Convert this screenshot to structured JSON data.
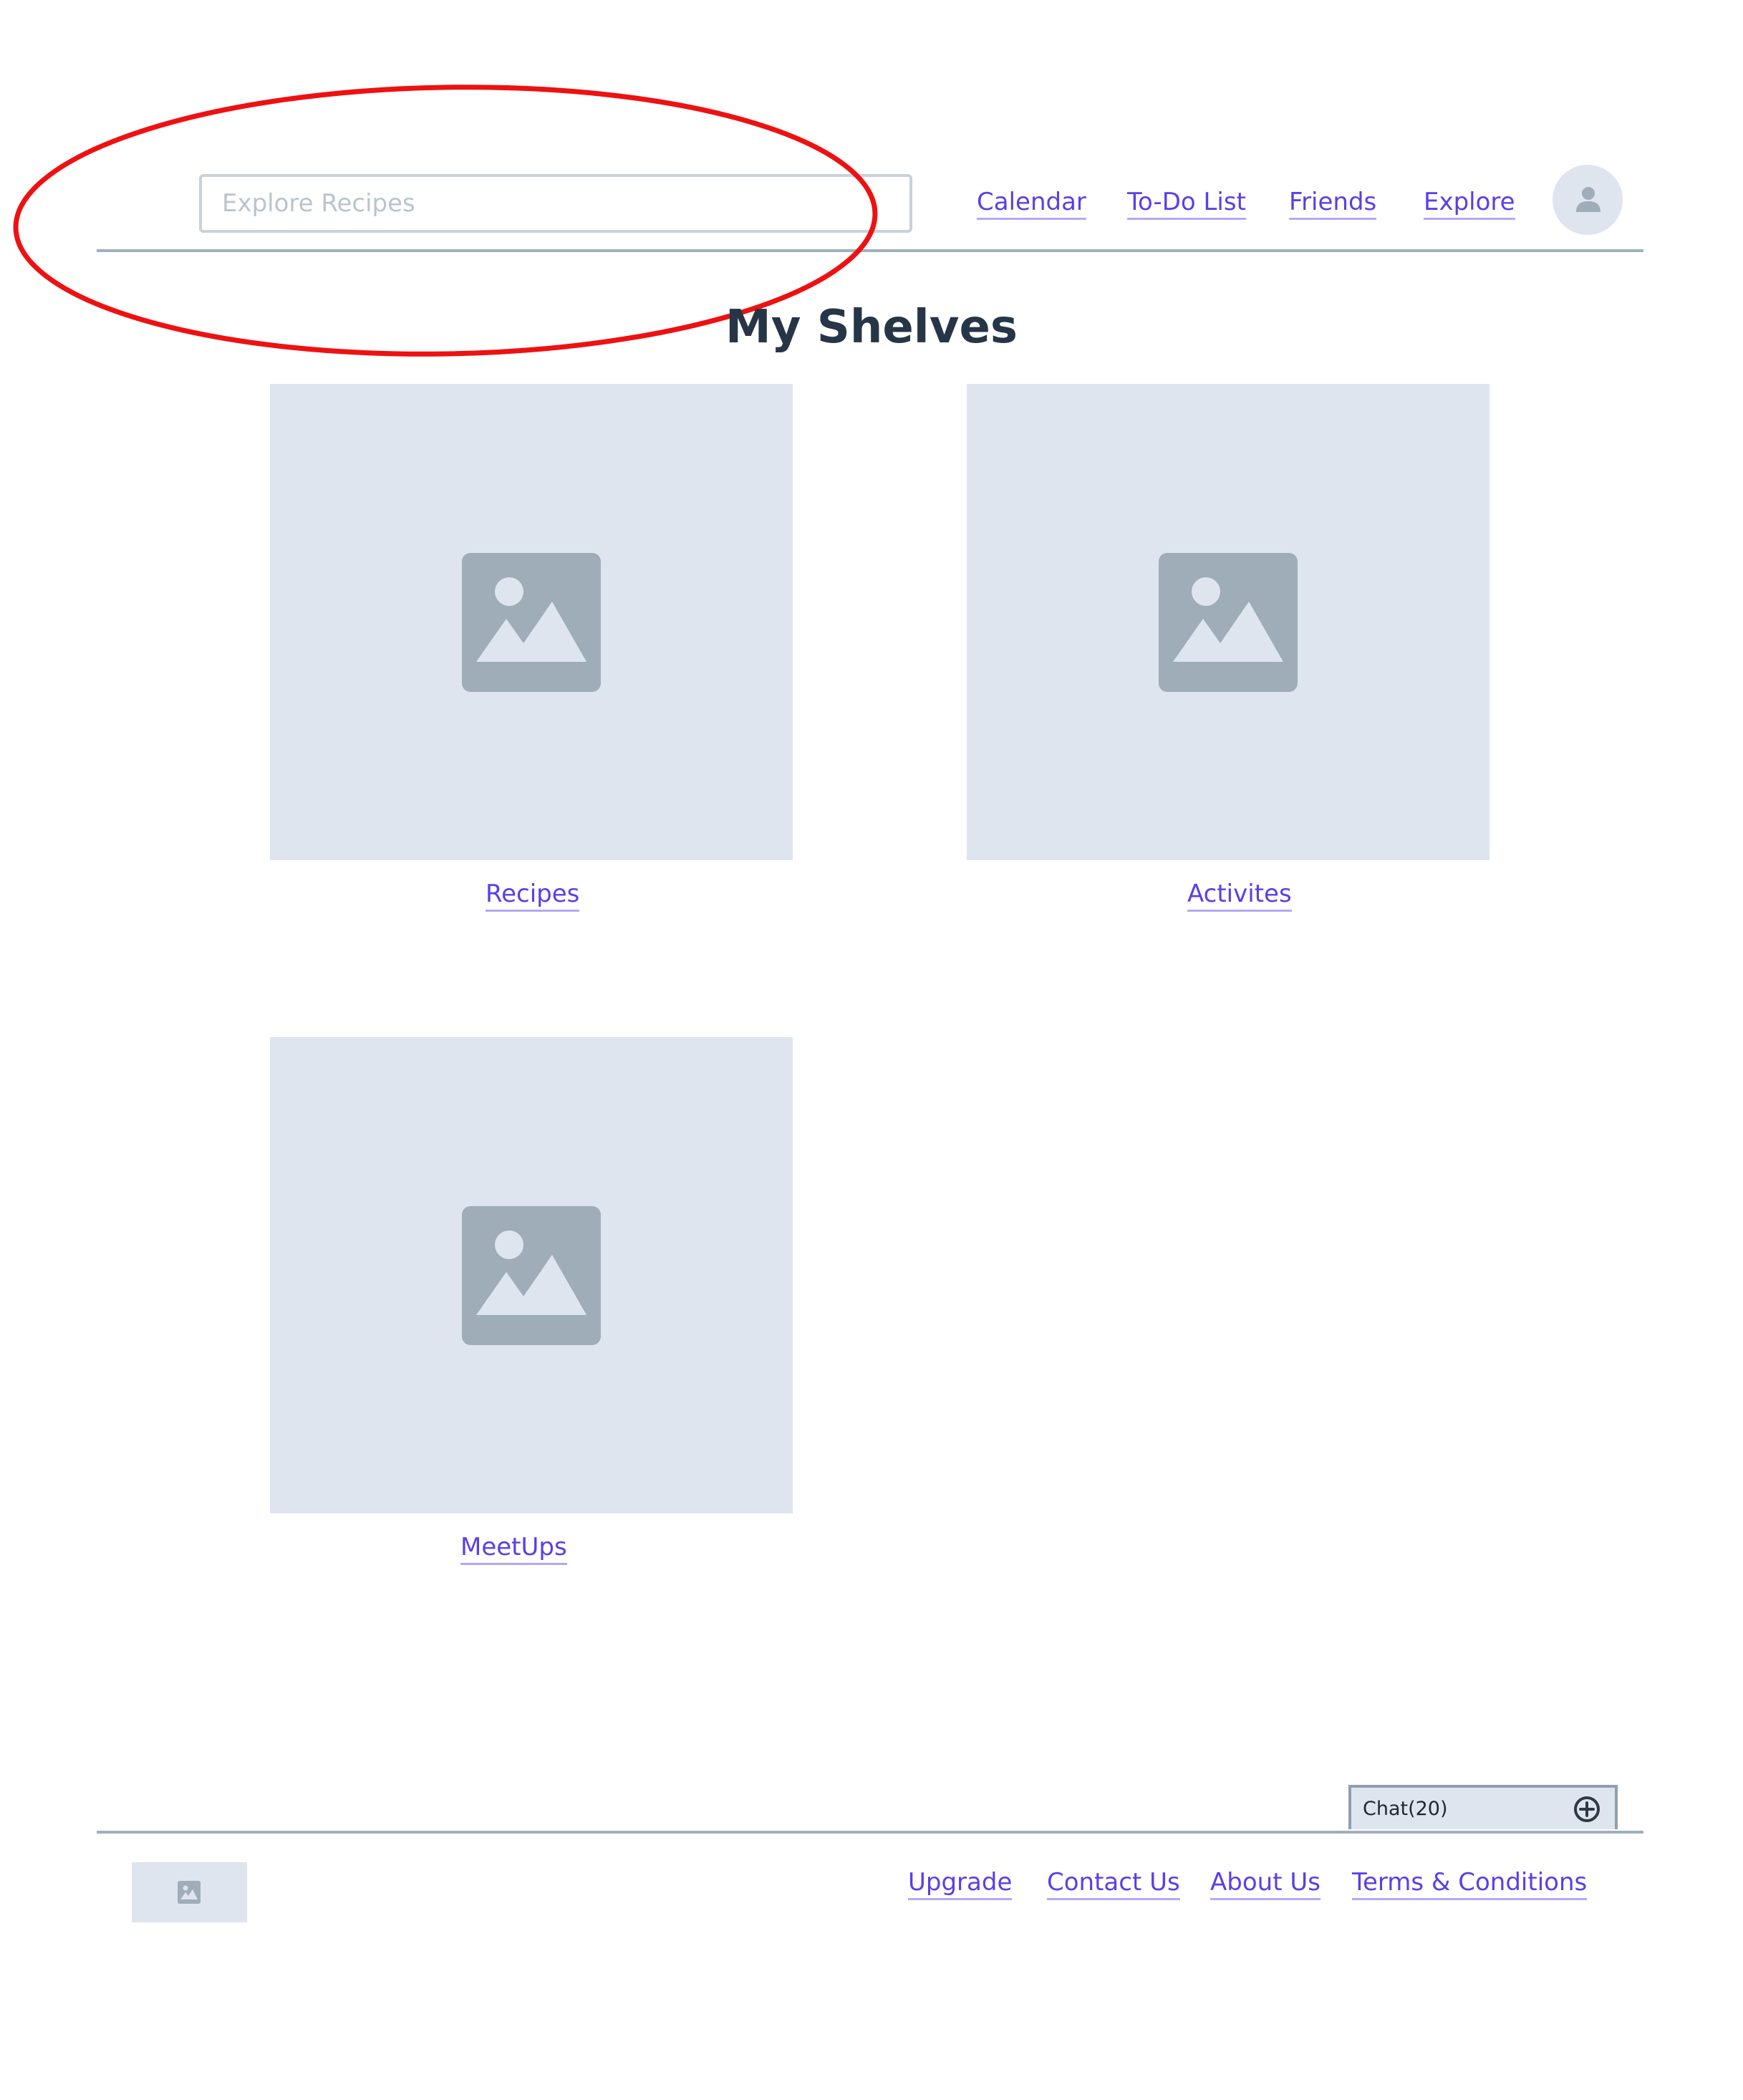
{
  "header": {
    "search": {
      "placeholder": "Explore Recipes",
      "value": ""
    },
    "nav": [
      {
        "label": "Calendar"
      },
      {
        "label": "To-Do List"
      },
      {
        "label": "Friends"
      },
      {
        "label": "Explore"
      }
    ],
    "avatar_icon": "user-icon"
  },
  "main": {
    "title": "My Shelves",
    "shelves": [
      {
        "label": "Recipes",
        "icon": "image-placeholder-icon"
      },
      {
        "label": "Activites",
        "icon": "image-placeholder-icon"
      },
      {
        "label": "MeetUps",
        "icon": "image-placeholder-icon"
      }
    ]
  },
  "chat": {
    "label": "Chat(20)",
    "icon": "plus-circle-icon"
  },
  "footer": {
    "logo_icon": "image-icon",
    "links": [
      {
        "label": "Upgrade"
      },
      {
        "label": "Contact Us"
      },
      {
        "label": "About Us"
      },
      {
        "label": "Terms & Conditions"
      }
    ]
  },
  "colors": {
    "link": "#5a3fe6",
    "placeholder_bg": "#dfe5ee",
    "placeholder_icon": "#9fadb9",
    "title": "#263646",
    "rule": "#9fb0bf",
    "annotation": "#ee1111"
  }
}
